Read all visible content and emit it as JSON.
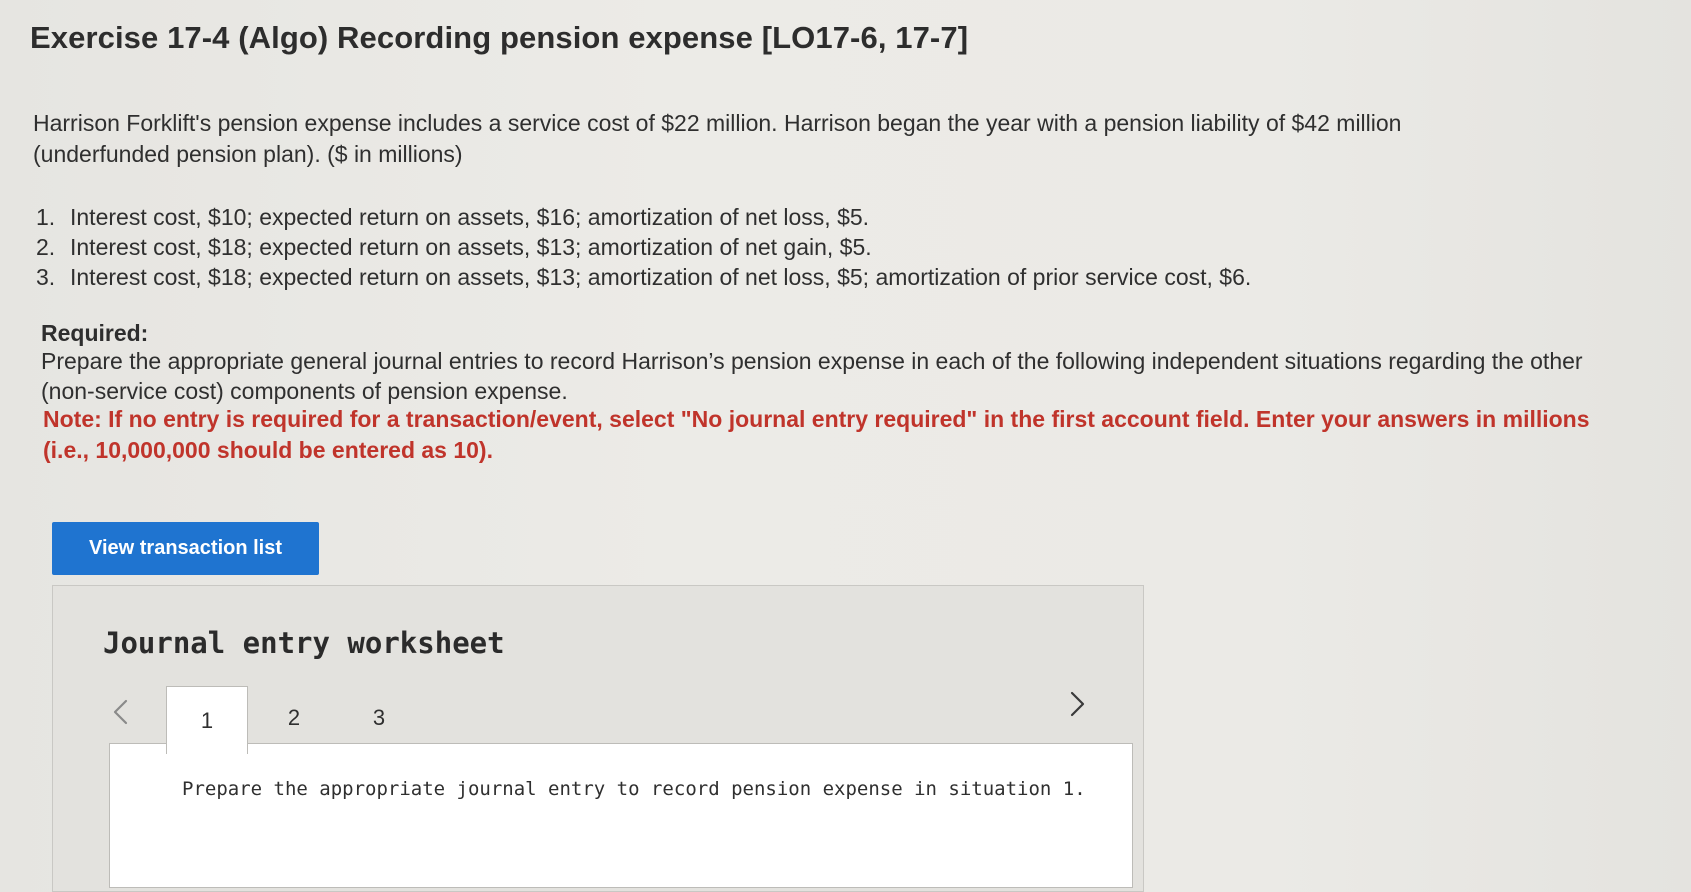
{
  "exercise": {
    "title": "Exercise 17-4 (Algo) Recording pension expense [LO17-6, 17-7]",
    "intro": "Harrison Forklift's pension expense includes a service cost of $22 million. Harrison began the year with a pension liability of $42 million (underfunded pension plan). ($ in millions)",
    "situations": [
      {
        "num": "1.",
        "text": "Interest cost, $10; expected return on assets, $16; amortization of net loss, $5."
      },
      {
        "num": "2.",
        "text": "Interest cost, $18; expected return on assets, $13; amortization of net gain, $5."
      },
      {
        "num": "3.",
        "text": "Interest cost, $18; expected return on assets, $13; amortization of net loss, $5; amortization of prior service cost, $6."
      }
    ],
    "required_label": "Required:",
    "required_text": "Prepare the appropriate general journal entries to record Harrison’s pension expense in each of the following independent situations regarding the other (non-service cost) components of pension expense.",
    "note": "Note: If no entry is required for a transaction/event, select \"No journal entry required\" in the first account field. Enter your answers in millions (i.e., 10,000,000 should be entered as 10)."
  },
  "toolbar": {
    "view_transactions_label": "View transaction list"
  },
  "worksheet": {
    "title": "Journal entry worksheet",
    "tabs": [
      {
        "label": "1",
        "active": true
      },
      {
        "label": "2",
        "active": false
      },
      {
        "label": "3",
        "active": false
      }
    ],
    "instruction": "Prepare the appropriate journal entry to record pension expense in situation 1."
  },
  "icons": {
    "prev": "chevron-left-icon",
    "next": "chevron-right-icon"
  },
  "colors": {
    "button_bg": "#1f74d0",
    "note_red": "#c0342b"
  }
}
